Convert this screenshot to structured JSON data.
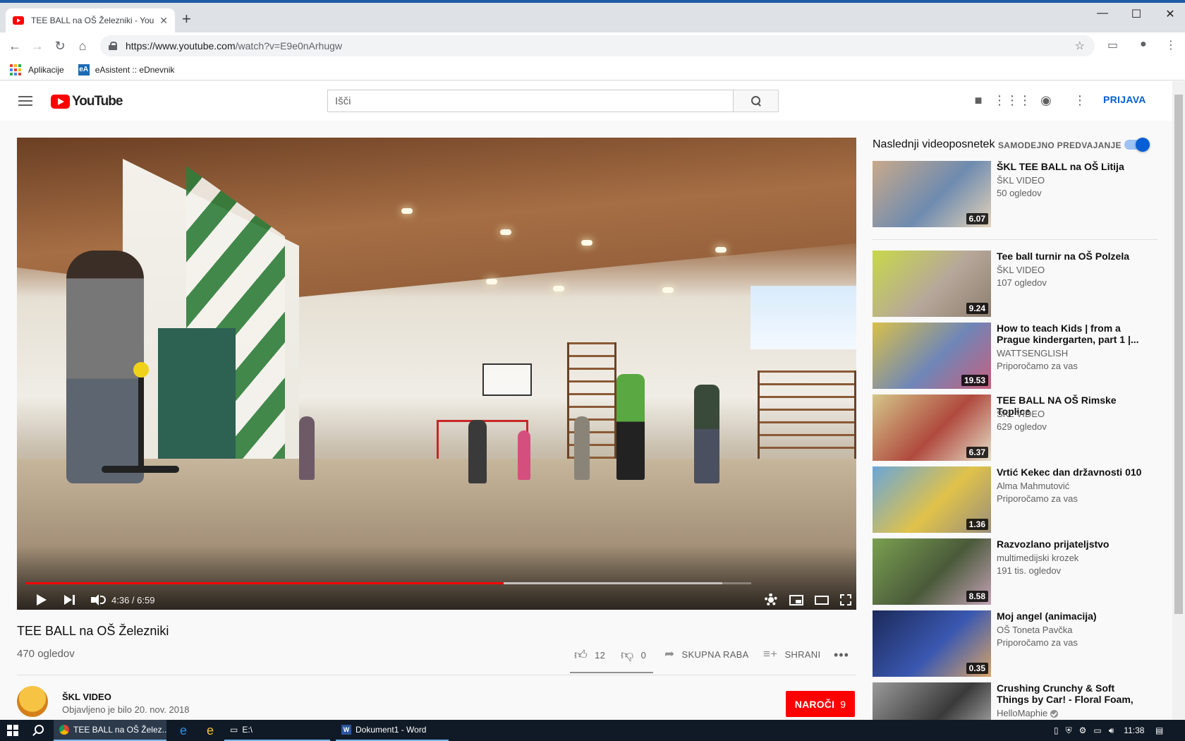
{
  "browser": {
    "tab_title": "TEE BALL na OŠ Železniki - YouTube",
    "tab_close": "✕",
    "new_tab": "+",
    "minimize": "—",
    "maximize": "☐",
    "close": "✕",
    "url_host": "https://www.youtube.com",
    "url_path": "/watch?v=E9e0nArhugw",
    "bookmarks": [
      {
        "label": "Aplikacije"
      },
      {
        "label": "eAsistent :: eDnevnik",
        "icon_text": "eA"
      }
    ]
  },
  "header": {
    "logo_text": "YouTube",
    "search_placeholder": "Išči",
    "signin_label": "PRIJAVA"
  },
  "player": {
    "time_current": "4:36",
    "time_total": "6:59",
    "time_display": "4:36 / 6:59",
    "played_fraction": 0.659,
    "buffered_fraction": 0.96
  },
  "video": {
    "title": "TEE BALL na OŠ Železniki",
    "views": "470 ogledov",
    "likes": "12",
    "dislikes": "0",
    "share_label": "SKUPNA RABA",
    "save_label": "SHRANI",
    "more": "•••",
    "channel_name": "ŠKL VIDEO",
    "published": "Objavljeno je bilo 20. nov. 2018",
    "subscribe_label": "NAROČI",
    "subscriber_count": "9"
  },
  "sidebar": {
    "up_next_title": "Naslednji videoposnetek",
    "autoplay_label": "SAMODEJNO PREDVAJANJE",
    "autoplay_on": true,
    "items": [
      {
        "title": "ŠKL TEE BALL na OŠ Litija",
        "channel": "ŠKL VIDEO",
        "meta": "50 ogledov",
        "duration": "6.07",
        "colors": [
          "#c9a98a",
          "#6e8bb0",
          "#e4d2b8"
        ]
      },
      {
        "title": "Tee ball turnir na OŠ Polzela",
        "channel": "ŠKL VIDEO",
        "meta": "107 ogledov",
        "duration": "9.24",
        "colors": [
          "#c8d84a",
          "#b6a79a",
          "#8e7f6f"
        ]
      },
      {
        "title": "How to teach Kids | from a Prague kindergarten, part 1 |...",
        "channel": "WATTSENGLISH",
        "meta": "Priporočamo za vas",
        "duration": "19.53",
        "colors": [
          "#d8c04a",
          "#6f86b8",
          "#c75f7d"
        ]
      },
      {
        "title": "TEE BALL NA OŠ Rimske Toplice",
        "channel": "ŠKL VIDEO",
        "meta": "629 ogledov",
        "duration": "6.37",
        "colors": [
          "#d4c68a",
          "#b04a3e",
          "#e6dfc9"
        ]
      },
      {
        "title": "Vrtić Kekec dan državnosti 010",
        "channel": "Alma Mahmutović",
        "meta": "Priporočamo za vas",
        "duration": "1.36",
        "colors": [
          "#6aa6d8",
          "#e0c24a",
          "#9a8f7a"
        ]
      },
      {
        "title": "Razvozlano prijateljstvo",
        "channel": "multimedijski krozek",
        "meta": "191 tis. ogledov",
        "duration": "8.58",
        "colors": [
          "#7aa050",
          "#4a5a3a",
          "#c4a2b6"
        ]
      },
      {
        "title": "Moj angel (animacija)",
        "channel": "OŠ Toneta Pavčka",
        "meta": "Priporočamo za vas",
        "duration": "0.35",
        "colors": [
          "#1c2a5a",
          "#3a58b0",
          "#d8a468"
        ]
      },
      {
        "title": "Crushing Crunchy & Soft Things by Car! - Floral Foam, Squishy,...",
        "channel": "HelloMaphie",
        "meta": "",
        "duration": "",
        "colors": [
          "#9a9a9a",
          "#3a3a3a",
          "#c4c4c4"
        ],
        "verified": true
      }
    ]
  },
  "taskbar": {
    "items": [
      {
        "label": "TEE BALL na OŠ Želez..."
      },
      {
        "label": "E:\\"
      },
      {
        "label": "Dokument1 - Word"
      }
    ],
    "clock": "11:38"
  }
}
